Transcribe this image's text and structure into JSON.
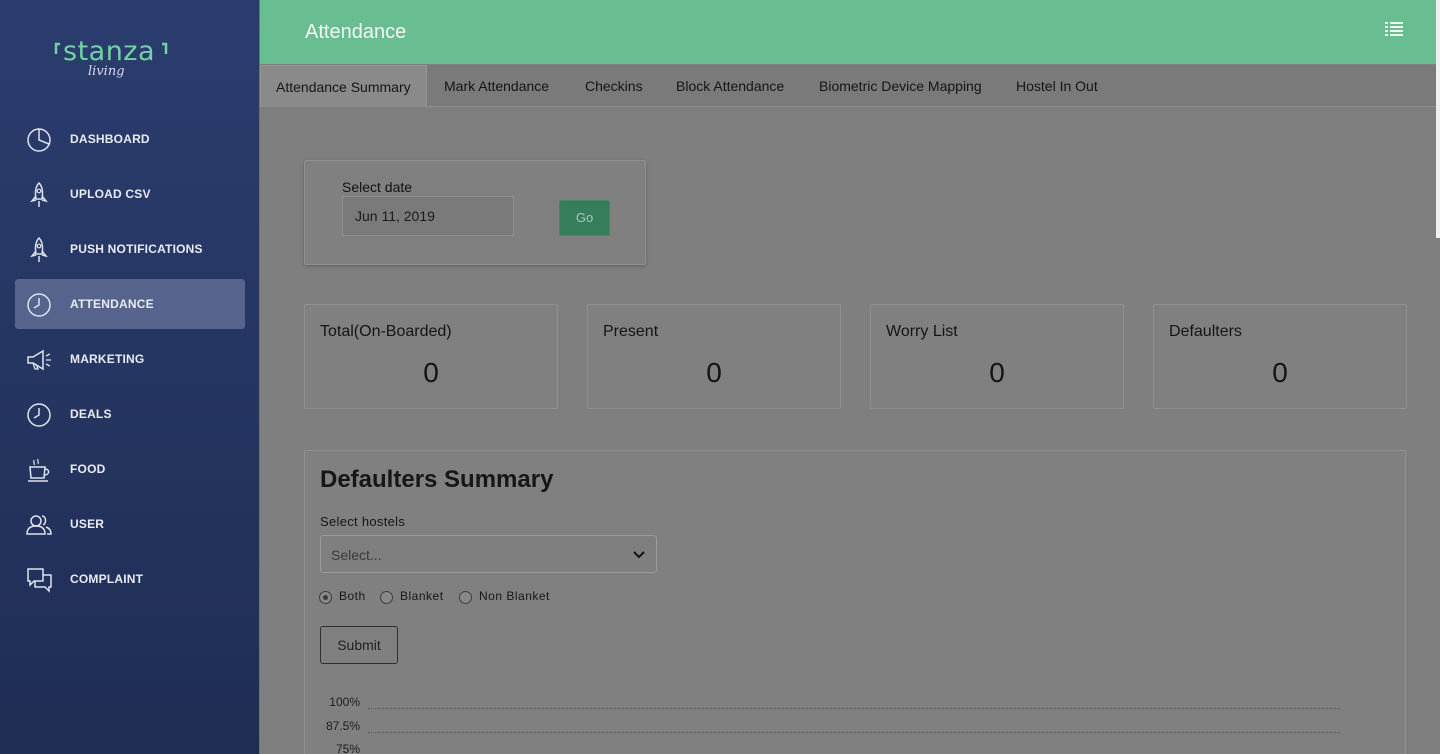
{
  "logo": {
    "word": "stanza",
    "script": "living"
  },
  "sidebar": {
    "items": [
      {
        "label": "DASHBOARD",
        "icon": "pie-chart-icon"
      },
      {
        "label": "UPLOAD CSV",
        "icon": "rocket-icon"
      },
      {
        "label": "PUSH NOTIFICATIONS",
        "icon": "rocket-icon"
      },
      {
        "label": "ATTENDANCE",
        "icon": "clock-icon",
        "active": true
      },
      {
        "label": "MARKETING",
        "icon": "megaphone-icon"
      },
      {
        "label": "DEALS",
        "icon": "clock-icon"
      },
      {
        "label": "FOOD",
        "icon": "coffee-cup-icon"
      },
      {
        "label": "USER",
        "icon": "users-icon"
      },
      {
        "label": "COMPLAINT",
        "icon": "chat-bubbles-icon"
      }
    ]
  },
  "header": {
    "title": "Attendance",
    "menu_icon": "list-icon"
  },
  "tabs": [
    {
      "label": "Attendance Summary",
      "active": true
    },
    {
      "label": "Mark Attendance"
    },
    {
      "label": "Checkins"
    },
    {
      "label": "Block Attendance"
    },
    {
      "label": "Biometric Device Mapping"
    },
    {
      "label": "Hostel In Out"
    }
  ],
  "date_filter": {
    "label": "Select date",
    "value": "Jun 11, 2019",
    "go_label": "Go"
  },
  "stats": [
    {
      "title": "Total(On-Boarded)",
      "value": "0"
    },
    {
      "title": "Present",
      "value": "0"
    },
    {
      "title": "Worry List",
      "value": "0"
    },
    {
      "title": "Defaulters",
      "value": "0"
    }
  ],
  "defaulters": {
    "title": "Defaulters Summary",
    "select_label": "Select hostels",
    "select_placeholder": "Select...",
    "radios": [
      {
        "label": "Both",
        "checked": true
      },
      {
        "label": "Blanket",
        "checked": false
      },
      {
        "label": "Non Blanket",
        "checked": false
      }
    ],
    "submit_label": "Submit",
    "y_ticks": [
      "100%",
      "87.5%",
      "75%"
    ]
  },
  "colors": {
    "sidebar": "#2b3d6e",
    "header": "#69be91",
    "go_button": "#357d5b",
    "overlay_gray": "#7f7f7f"
  }
}
